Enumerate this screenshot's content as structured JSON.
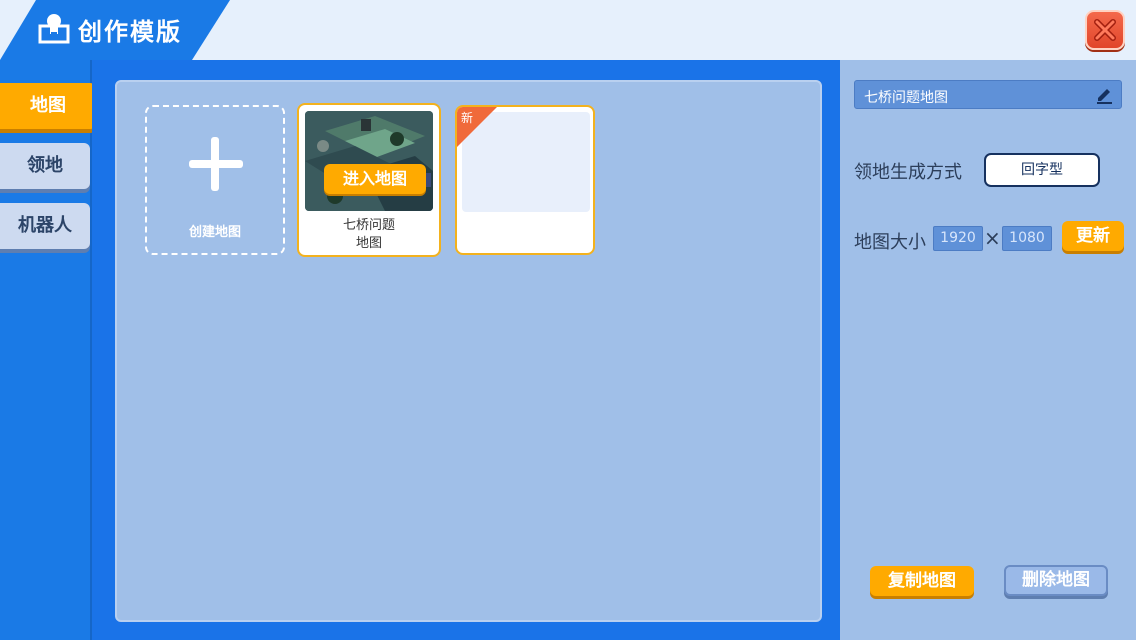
{
  "header": {
    "title": "创作模版",
    "title_icon": "bulb-box-icon",
    "close_icon": "close-icon"
  },
  "sidebar": {
    "items": [
      {
        "label": "地图",
        "active": true
      },
      {
        "label": "领地",
        "active": false
      },
      {
        "label": "机器人",
        "active": false
      }
    ]
  },
  "main": {
    "create_card": {
      "label": "创建地图",
      "icon": "plus-icon"
    },
    "map_card": {
      "enter_label": "进入地图",
      "name_line1": "七桥问题",
      "name_line2": "地图"
    },
    "new_card": {
      "badge": "新"
    }
  },
  "right": {
    "map_name": "七桥问题地图",
    "edit_icon": "pencil-icon",
    "gen_label": "领地生成方式",
    "gen_value": "回字型",
    "size_label": "地图大小",
    "width": "1920",
    "height": "1080",
    "times": "×",
    "update_label": "更新",
    "copy_label": "复制地图",
    "delete_label": "删除地图"
  },
  "colors": {
    "accent": "#ffaa00",
    "primary_blue": "#1a7ae6",
    "panel_blue": "#a0bfe8",
    "close_red": "#e1452a"
  }
}
